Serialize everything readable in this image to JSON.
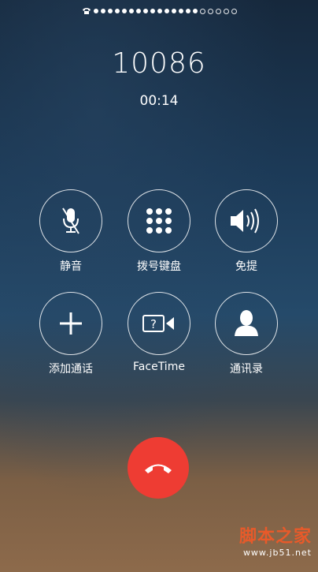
{
  "call": {
    "number": "10086",
    "timer": "00:14"
  },
  "buttons": [
    {
      "label": "静音",
      "icon": "mute-microphone-icon"
    },
    {
      "label": "拨号键盘",
      "icon": "keypad-icon"
    },
    {
      "label": "免提",
      "icon": "speaker-icon"
    },
    {
      "label": "添加通话",
      "icon": "plus-icon"
    },
    {
      "label": "FaceTime",
      "icon": "facetime-video-icon"
    },
    {
      "label": "通讯录",
      "icon": "contact-person-icon"
    }
  ],
  "end_call": {
    "icon": "end-call-icon",
    "color": "#ee3c33"
  },
  "watermark": {
    "title": "脚本之家",
    "url": "www.jb51.net"
  }
}
